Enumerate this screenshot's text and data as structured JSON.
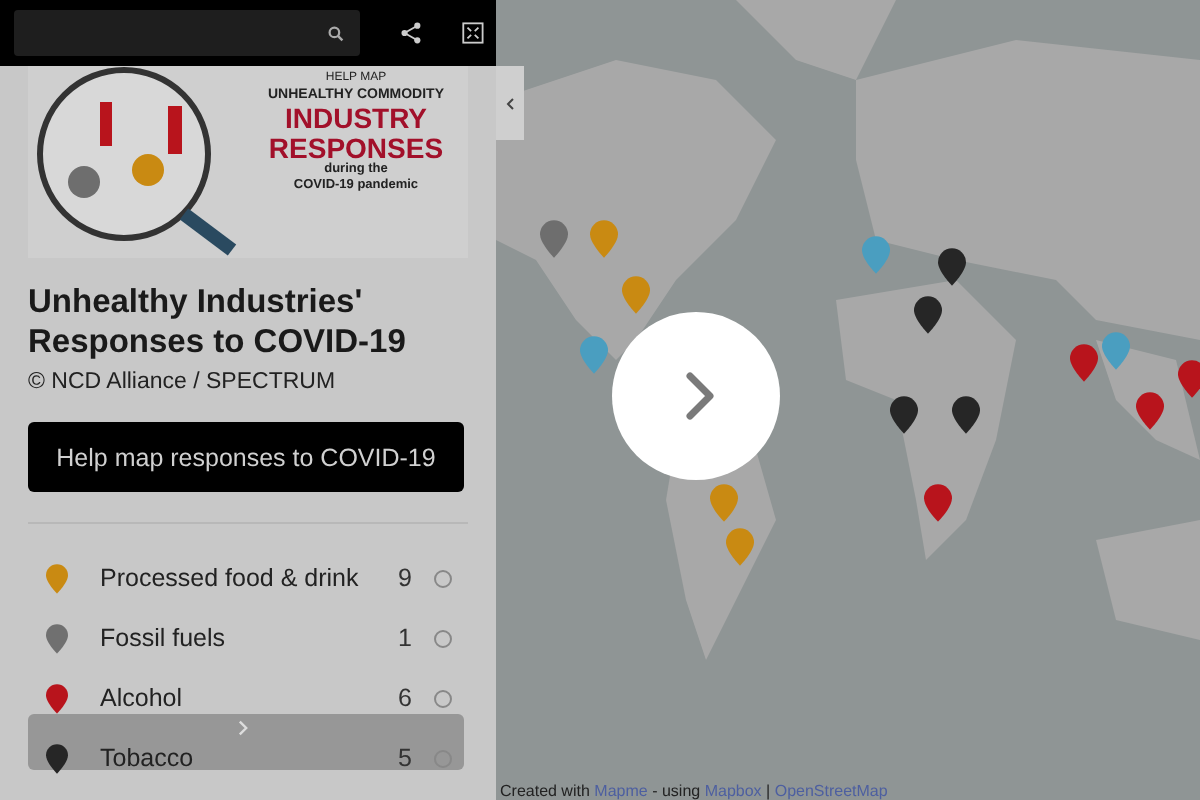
{
  "banner": {
    "lines": [
      "HELP MAP",
      "UNHEALTHY COMMODITY",
      "INDUSTRY",
      "RESPONSES",
      "during the",
      "COVID-19 pandemic"
    ]
  },
  "title": "Unhealthy Industries' Responses to COVID-19",
  "subtitle": "© NCD Alliance / SPECTRUM",
  "cta_button": "Help map responses to COVID-19",
  "categories": [
    {
      "name": "Processed food & drink",
      "count": "9",
      "color": "#c98a12",
      "selected": false
    },
    {
      "name": "Fossil fuels",
      "count": "1",
      "color": "#707070",
      "selected": false
    },
    {
      "name": "Alcohol",
      "count": "6",
      "color": "#b8141c",
      "selected": false
    },
    {
      "name": "Tobacco",
      "count": "5",
      "color": "#262626",
      "selected": false
    }
  ],
  "attribution": [
    {
      "text": "Created with",
      "link": false
    },
    {
      "text": "Mapme",
      "link": true
    },
    {
      "text": "- using",
      "link": false
    },
    {
      "text": "Mapbox",
      "link": true
    },
    {
      "text": "|",
      "link": false
    },
    {
      "text": "OpenStreetMap",
      "link": true
    }
  ]
}
